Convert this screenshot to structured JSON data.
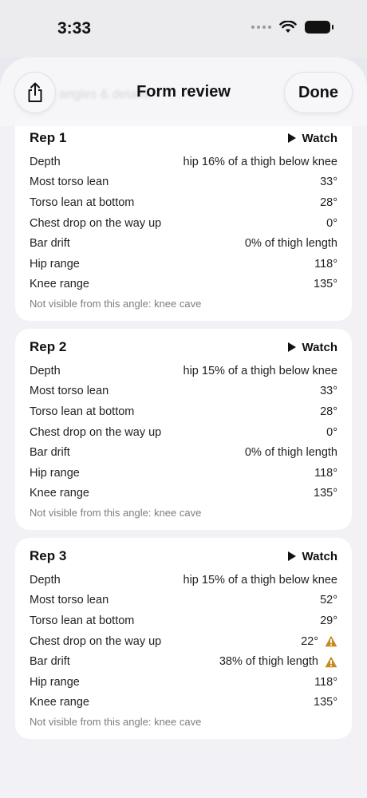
{
  "status": {
    "time": "3:33"
  },
  "header": {
    "title": "Form review",
    "done_label": "Done",
    "ghost": "angles & details"
  },
  "colors": {
    "warning": "#c58a1f",
    "card": "#ffffff",
    "sheet": "#f2f2f6"
  },
  "reps": [
    {
      "title": "Rep 1",
      "watch": "Watch",
      "rows": [
        {
          "label": "Depth",
          "value": "hip 16% of a thigh below knee",
          "warn": false
        },
        {
          "label": "Most torso lean",
          "value": "33°",
          "warn": false
        },
        {
          "label": "Torso lean at bottom",
          "value": "28°",
          "warn": false
        },
        {
          "label": "Chest drop on the way up",
          "value": "0°",
          "warn": false
        },
        {
          "label": "Bar drift",
          "value": "0% of thigh length",
          "warn": false
        },
        {
          "label": "Hip range",
          "value": "118°",
          "warn": false
        },
        {
          "label": "Knee range",
          "value": "135°",
          "warn": false
        }
      ],
      "note": "Not visible from this angle: knee cave"
    },
    {
      "title": "Rep 2",
      "watch": "Watch",
      "rows": [
        {
          "label": "Depth",
          "value": "hip 15% of a thigh below knee",
          "warn": false
        },
        {
          "label": "Most torso lean",
          "value": "33°",
          "warn": false
        },
        {
          "label": "Torso lean at bottom",
          "value": "28°",
          "warn": false
        },
        {
          "label": "Chest drop on the way up",
          "value": "0°",
          "warn": false
        },
        {
          "label": "Bar drift",
          "value": "0% of thigh length",
          "warn": false
        },
        {
          "label": "Hip range",
          "value": "118°",
          "warn": false
        },
        {
          "label": "Knee range",
          "value": "135°",
          "warn": false
        }
      ],
      "note": "Not visible from this angle: knee cave"
    },
    {
      "title": "Rep 3",
      "watch": "Watch",
      "rows": [
        {
          "label": "Depth",
          "value": "hip 15% of a thigh below knee",
          "warn": false
        },
        {
          "label": "Most torso lean",
          "value": "52°",
          "warn": false
        },
        {
          "label": "Torso lean at bottom",
          "value": "29°",
          "warn": false
        },
        {
          "label": "Chest drop on the way up",
          "value": "22°",
          "warn": true
        },
        {
          "label": "Bar drift",
          "value": "38% of thigh length",
          "warn": true
        },
        {
          "label": "Hip range",
          "value": "118°",
          "warn": false
        },
        {
          "label": "Knee range",
          "value": "135°",
          "warn": false
        }
      ],
      "note": "Not visible from this angle: knee cave"
    }
  ]
}
